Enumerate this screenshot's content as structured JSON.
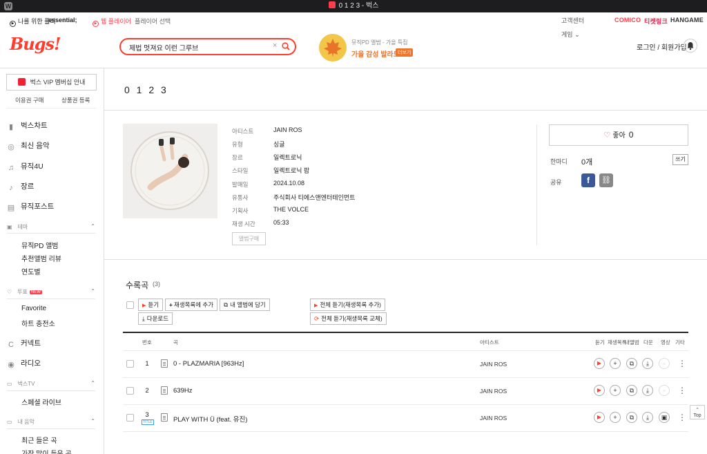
{
  "window": {
    "title": "0 1 2 3 - 벅스",
    "app_icon": "W"
  },
  "gnb": {
    "for_me": "나를 위한 플리",
    "essential": "essential;",
    "web_player": "웹 플레이어",
    "player_select": "플레이어 선택"
  },
  "brands": [
    "COMICO",
    "티켓링크",
    "HANGAME"
  ],
  "header": {
    "logo": "Bugs!",
    "search_value": "제법 멋져요 이런 그루브",
    "promo_sub": "뮤직PD 앨범 - 가을 특집",
    "promo_title": "가을 감성 발라드",
    "promo_badge": "더보기",
    "customer_center": "고객센터",
    "games": "게임",
    "login": "로그인 / 회원가입"
  },
  "sidebar": {
    "vip": "벅스 VIP 멤버십 안내",
    "buy": "이용권 구매",
    "register": "상품권 등록",
    "menu1": [
      {
        "icon": "chart-icon",
        "label": "벅스차트"
      },
      {
        "icon": "disc-icon",
        "label": "최신 음악"
      },
      {
        "icon": "note-icon",
        "label": "뮤직4U"
      },
      {
        "icon": "guitar-icon",
        "label": "장르"
      },
      {
        "icon": "post-icon",
        "label": "뮤직포스트"
      }
    ],
    "theme": "테마",
    "theme_items": [
      "뮤직PD 앨범",
      "추천앨범 리뷰",
      "연도별"
    ],
    "vote": "투표",
    "vote_badge": "NEW",
    "vote_items": [
      "Favorite",
      "하트 충전소"
    ],
    "menu2": [
      {
        "icon": "connect-icon",
        "label": "커넥트"
      },
      {
        "icon": "radio-icon",
        "label": "라디오"
      }
    ],
    "tv": "벅스TV",
    "tv_items": [
      "스페셜 라이브"
    ],
    "my": "내 음악",
    "my_items": [
      "최근 들은 곡",
      "가장 많이 들은 곡"
    ]
  },
  "album": {
    "title": "0 1 2 3",
    "info": [
      {
        "label": "아티스트",
        "value": "JAIN ROS"
      },
      {
        "label": "유형",
        "value": "싱글"
      },
      {
        "label": "장르",
        "value": "일렉트로닉"
      },
      {
        "label": "스타일",
        "value": "일렉트로닉 팝"
      },
      {
        "label": "발매일",
        "value": "2024.10.08"
      },
      {
        "label": "유통사",
        "value": "주식회사 티에스앤엔터테인먼트"
      },
      {
        "label": "기획사",
        "value": "THE VOLCE"
      },
      {
        "label": "재생 시간",
        "value": "05:33"
      }
    ],
    "buy_label": "앨범구매",
    "like_label": "좋아",
    "like_count": "0",
    "review_label": "한마디",
    "review_count": "0개",
    "write_label": "쓰기",
    "share_label": "공유"
  },
  "tracklist": {
    "title": "수록곡",
    "count": "(3)",
    "buttons": {
      "play": "듣기",
      "add_playlist": "재생목록에 추가",
      "add_album": "내 앨범에 담기",
      "download": "다운로드",
      "play_all_add": "전체 듣기(재생목록 추가)",
      "play_all_replace": "전체 듣기(재생목록 교체)"
    },
    "headers": {
      "no": "번호",
      "song": "곡",
      "artist": "아티스트",
      "listen": "듣기",
      "playlist": "재생목록",
      "myalbum": "내앨범",
      "download": "다운",
      "video": "영상",
      "etc": "기타"
    },
    "rows": [
      {
        "no": "1",
        "title": "0 - PLAZMARIA [963Hz]",
        "artist": "JAIN ROS",
        "badge": "",
        "video": false
      },
      {
        "no": "2",
        "title": "639Hz",
        "artist": "JAIN ROS",
        "badge": "",
        "video": false
      },
      {
        "no": "3",
        "title": "PLAY WITH Ü (feat. 유진)",
        "artist": "JAIN ROS",
        "badge": "TITLE",
        "video": true
      }
    ]
  },
  "top_label": "Top"
}
